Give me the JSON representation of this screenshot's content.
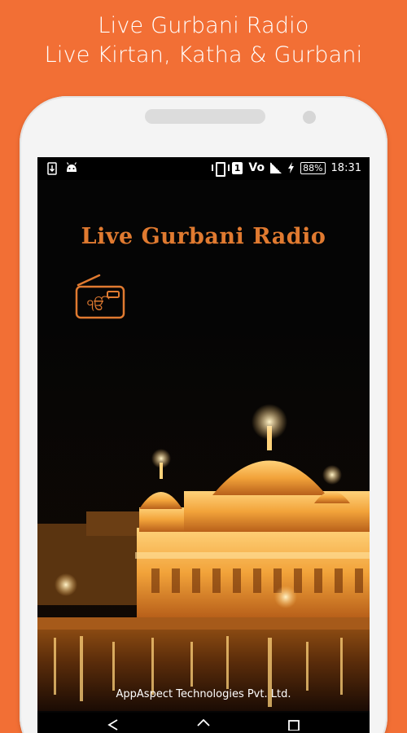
{
  "promo": {
    "line1": "Live Gurbani Radio",
    "line2": "Live Kirtan, Katha & Gurbani"
  },
  "statusbar": {
    "sim_slot": "1",
    "network": "Vo",
    "battery": "88%",
    "time": "18:31"
  },
  "app": {
    "title": "Live Gurbani Radio",
    "logo_glyph": "ੴ",
    "footer": "AppAspect Technologies Pvt. Ltd."
  },
  "colors": {
    "background": "#F26F35",
    "title": "#E07A30",
    "temple_gold": "#F2A33A"
  },
  "icons": [
    "sim-card-icon",
    "android-icon",
    "vibrate-icon",
    "signal-icon",
    "charging-icon",
    "battery-icon",
    "radio-icon",
    "back-icon",
    "home-icon",
    "recents-icon"
  ]
}
